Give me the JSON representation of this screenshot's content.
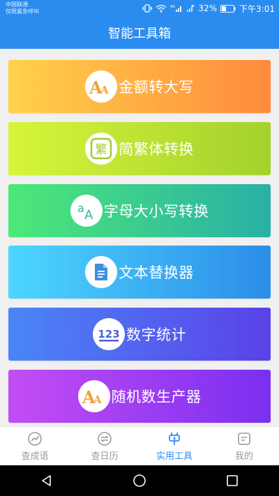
{
  "status": {
    "carrier_line1": "中国联通",
    "carrier_line2": "仅限紧急呼叫",
    "battery": "32%",
    "time": "下午3:01"
  },
  "header": {
    "title": "智能工具箱"
  },
  "tools": [
    {
      "label": "金额转大写",
      "icon": "aa-icon",
      "gradient": [
        "#ffd24a",
        "#ff8a3d"
      ]
    },
    {
      "label": "简繁体转换",
      "icon": "traditional-char-icon",
      "gradient": [
        "#d6f53a",
        "#a4d12d"
      ]
    },
    {
      "label": "字母大小写转换",
      "icon": "letter-case-icon",
      "gradient": [
        "#4de878",
        "#29b0a6"
      ]
    },
    {
      "label": "文本替换器",
      "icon": "document-icon",
      "gradient": [
        "#4dd6ff",
        "#2c8de8"
      ]
    },
    {
      "label": "数字统计",
      "icon": "number-123-icon",
      "gradient": [
        "#4a86f7",
        "#5a42e8"
      ]
    },
    {
      "label": "随机数生产器",
      "icon": "aa-icon",
      "gradient": [
        "#c44df5",
        "#7a2ff0"
      ]
    }
  ],
  "tabs": [
    {
      "label": "查成语",
      "icon": "trend-icon",
      "active": false
    },
    {
      "label": "查日历",
      "icon": "calendar-cycle-icon",
      "active": false
    },
    {
      "label": "实用工具",
      "icon": "tool-plug-icon",
      "active": true
    },
    {
      "label": "我的",
      "icon": "profile-doc-icon",
      "active": false
    }
  ],
  "colors": {
    "primary": "#2b8cf0",
    "inactive": "#9a9a9a"
  }
}
